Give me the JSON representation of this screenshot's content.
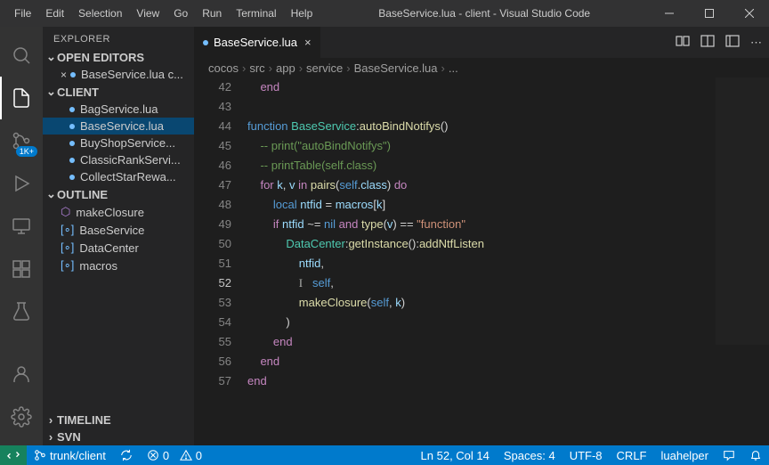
{
  "titlebar": {
    "menus": [
      "File",
      "Edit",
      "Selection",
      "View",
      "Go",
      "Run",
      "Terminal",
      "Help"
    ],
    "title": "BaseService.lua - client - Visual Studio Code"
  },
  "activitybar": {
    "badge": "1K+"
  },
  "sidebar": {
    "title": "EXPLORER",
    "sections": {
      "openEditors": {
        "label": "OPEN EDITORS",
        "items": [
          {
            "label": "BaseService.lua  c...",
            "close": true
          }
        ]
      },
      "client": {
        "label": "CLIENT",
        "items": [
          {
            "label": "BagService.lua"
          },
          {
            "label": "BaseService.lua",
            "active": true
          },
          {
            "label": "BuyShopService..."
          },
          {
            "label": "ClassicRankServi..."
          },
          {
            "label": "CollectStarRewa..."
          }
        ]
      },
      "outline": {
        "label": "OUTLINE",
        "items": [
          {
            "label": "makeClosure",
            "kind": "fn"
          },
          {
            "label": "BaseService",
            "kind": "ns"
          },
          {
            "label": "DataCenter",
            "kind": "ns"
          },
          {
            "label": "macros",
            "kind": "ns"
          }
        ]
      },
      "timeline": {
        "label": "TIMELINE"
      },
      "svn": {
        "label": "SVN"
      }
    }
  },
  "editor": {
    "tab": {
      "label": "BaseService.lua"
    },
    "breadcrumb": [
      "cocos",
      "src",
      "app",
      "service",
      "BaseService.lua",
      "..."
    ],
    "lines": [
      {
        "n": 42,
        "segs": [
          [
            "    ",
            "op"
          ],
          [
            "end",
            "kw"
          ]
        ]
      },
      {
        "n": 43,
        "segs": []
      },
      {
        "n": 44,
        "segs": [
          [
            "function",
            "fn"
          ],
          [
            " ",
            "op"
          ],
          [
            "BaseService",
            "ty"
          ],
          [
            ":",
            "op"
          ],
          [
            "autoBindNotifys",
            "mth"
          ],
          [
            "()",
            "op"
          ]
        ]
      },
      {
        "n": 45,
        "segs": [
          [
            "    ",
            "op"
          ],
          [
            "-- print(\"autoBindNotifys\")",
            "cm"
          ]
        ]
      },
      {
        "n": 46,
        "segs": [
          [
            "    ",
            "op"
          ],
          [
            "-- printTable(self.class)",
            "cm"
          ]
        ]
      },
      {
        "n": 47,
        "segs": [
          [
            "    ",
            "op"
          ],
          [
            "for",
            "kw"
          ],
          [
            " ",
            "op"
          ],
          [
            "k",
            "var"
          ],
          [
            ", ",
            "op"
          ],
          [
            "v",
            "var"
          ],
          [
            " ",
            "op"
          ],
          [
            "in",
            "kw"
          ],
          [
            " ",
            "op"
          ],
          [
            "pairs",
            "mth"
          ],
          [
            "(",
            "op"
          ],
          [
            "self",
            "self"
          ],
          [
            ".",
            "op"
          ],
          [
            "class",
            "var"
          ],
          [
            ") ",
            "op"
          ],
          [
            "do",
            "kw"
          ]
        ]
      },
      {
        "n": 48,
        "segs": [
          [
            "        ",
            "op"
          ],
          [
            "local",
            "fn"
          ],
          [
            " ",
            "op"
          ],
          [
            "ntfid",
            "var"
          ],
          [
            " = ",
            "op"
          ],
          [
            "macros",
            "var"
          ],
          [
            "[",
            "op"
          ],
          [
            "k",
            "var"
          ],
          [
            "]",
            "op"
          ]
        ]
      },
      {
        "n": 49,
        "segs": [
          [
            "        ",
            "op"
          ],
          [
            "if",
            "kw"
          ],
          [
            " ",
            "op"
          ],
          [
            "ntfid",
            "var"
          ],
          [
            " ~= ",
            "op"
          ],
          [
            "nil",
            "nil"
          ],
          [
            " ",
            "op"
          ],
          [
            "and",
            "kw"
          ],
          [
            " ",
            "op"
          ],
          [
            "type",
            "mth"
          ],
          [
            "(",
            "op"
          ],
          [
            "v",
            "var"
          ],
          [
            ") == ",
            "op"
          ],
          [
            "\"function\"",
            "str"
          ]
        ]
      },
      {
        "n": 50,
        "segs": [
          [
            "            ",
            "op"
          ],
          [
            "DataCenter",
            "ty"
          ],
          [
            ":",
            "op"
          ],
          [
            "getInstance",
            "mth"
          ],
          [
            "():",
            "op"
          ],
          [
            "addNtfListen",
            "mth"
          ]
        ]
      },
      {
        "n": 51,
        "segs": [
          [
            "                ",
            "op"
          ],
          [
            "ntfid",
            "var"
          ],
          [
            ",",
            "op"
          ]
        ]
      },
      {
        "n": 52,
        "cur": true,
        "cursor": true,
        "segs": [
          [
            "                ",
            "op"
          ],
          [
            "self",
            "self"
          ],
          [
            ",",
            "op"
          ]
        ]
      },
      {
        "n": 53,
        "segs": [
          [
            "                ",
            "op"
          ],
          [
            "makeClosure",
            "mth"
          ],
          [
            "(",
            "op"
          ],
          [
            "self",
            "self"
          ],
          [
            ", ",
            "op"
          ],
          [
            "k",
            "var"
          ],
          [
            ")",
            "op"
          ]
        ]
      },
      {
        "n": 54,
        "segs": [
          [
            "            ",
            "op"
          ],
          [
            ")",
            "op"
          ]
        ]
      },
      {
        "n": 55,
        "segs": [
          [
            "        ",
            "op"
          ],
          [
            "end",
            "kw"
          ]
        ]
      },
      {
        "n": 56,
        "segs": [
          [
            "    ",
            "op"
          ],
          [
            "end",
            "kw"
          ]
        ]
      },
      {
        "n": 57,
        "segs": [
          [
            "end",
            "kw"
          ]
        ]
      }
    ]
  },
  "statusbar": {
    "left": {
      "branch": "trunk/client",
      "sync": "",
      "errors": "0",
      "warnings": "0"
    },
    "right": {
      "pos": "Ln 52, Col 14",
      "spaces": "Spaces: 4",
      "encoding": "UTF-8",
      "eol": "CRLF",
      "lang": "luahelper"
    }
  }
}
